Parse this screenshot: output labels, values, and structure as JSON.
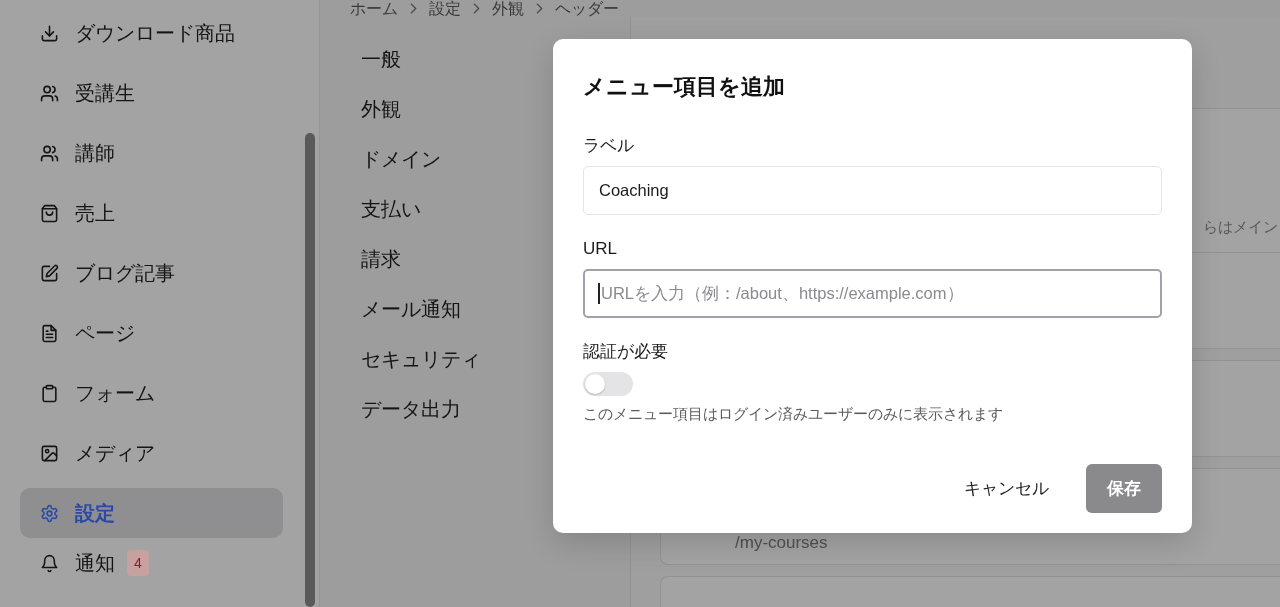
{
  "sidebar": {
    "items": [
      {
        "label": "ダウンロード商品",
        "selected": false
      },
      {
        "label": "受講生",
        "selected": false
      },
      {
        "label": "講師",
        "selected": false
      },
      {
        "label": "売上",
        "selected": false
      },
      {
        "label": "ブログ記事",
        "selected": false
      },
      {
        "label": "ページ",
        "selected": false
      },
      {
        "label": "フォーム",
        "selected": false
      },
      {
        "label": "メディア",
        "selected": false
      },
      {
        "label": "設定",
        "selected": true
      },
      {
        "label": "通知",
        "selected": false,
        "badge": "4"
      }
    ]
  },
  "breadcrumb": [
    "ホーム",
    "設定",
    "外観",
    "ヘッダー"
  ],
  "settings_nav": {
    "items": [
      {
        "label": "一般"
      },
      {
        "label": "外観"
      },
      {
        "label": "ドメイン"
      },
      {
        "label": "支払い"
      },
      {
        "label": "請求"
      },
      {
        "label": "メール通知"
      },
      {
        "label": "セキュリティ"
      },
      {
        "label": "データ出力"
      }
    ]
  },
  "content": {
    "description": "らはメイン",
    "menu_items": [
      {
        "kind": "blank"
      },
      {
        "kind": "blank"
      },
      {
        "kind": "path",
        "path": "/my-courses"
      },
      {
        "kind": "blank"
      }
    ]
  },
  "dialog": {
    "title": "メニュー項目を追加",
    "fields": [
      {
        "kind": "text",
        "label": "ラベル",
        "value": "Coaching",
        "focused": false
      },
      {
        "kind": "text",
        "label": "URL",
        "placeholder": "URLを入力（例：/about、https://example.com）",
        "focused": true
      },
      {
        "kind": "toggle",
        "label": "認証が必要",
        "on": false,
        "help": "このメニュー項目はログイン済みユーザーのみに表示されます"
      }
    ],
    "buttons": [
      {
        "kind": "secondary",
        "label": "キャンセル",
        "disabled": false
      },
      {
        "kind": "primary",
        "label": "保存",
        "disabled": true
      }
    ]
  }
}
